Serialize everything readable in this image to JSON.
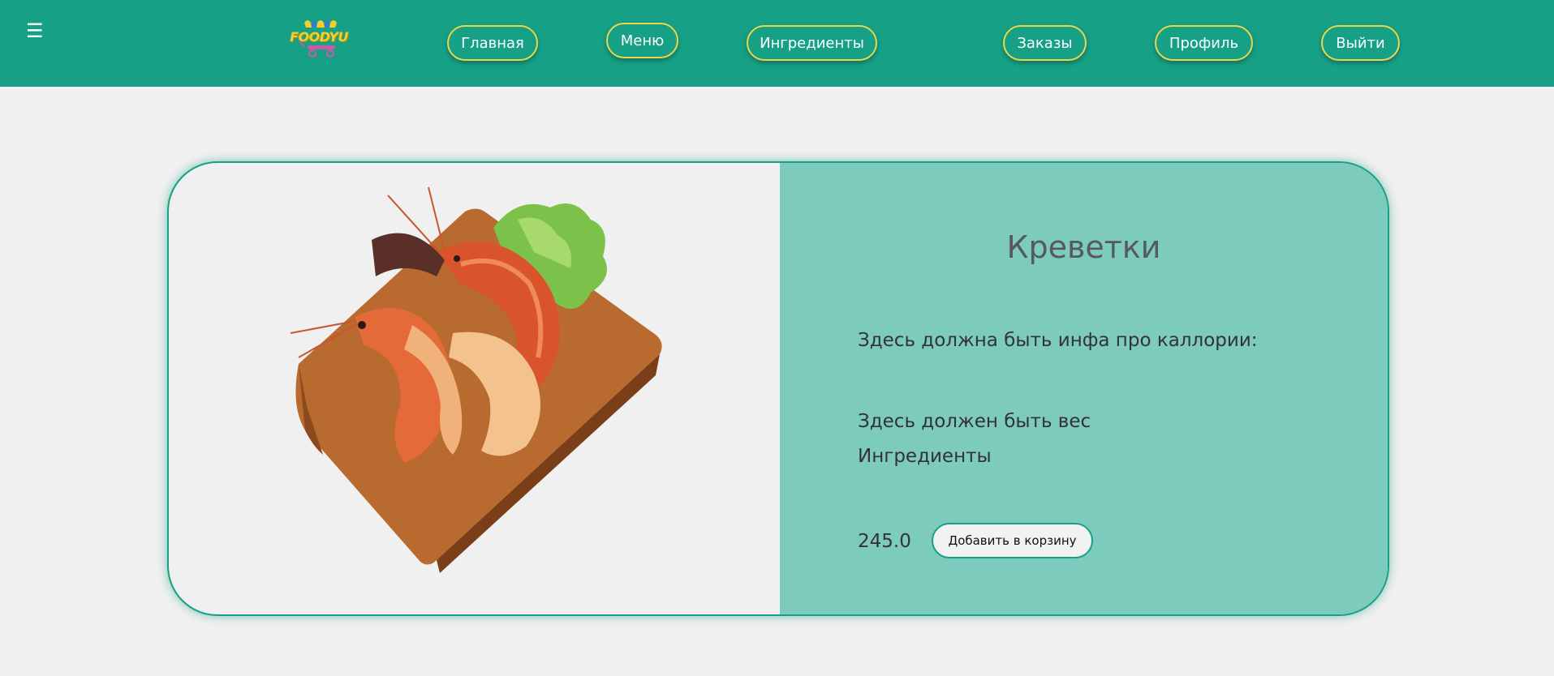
{
  "header": {
    "menu_icon": "hamburger-icon",
    "logo_text": "FOODYU",
    "nav": [
      {
        "label": "Главная"
      },
      {
        "label": "Меню"
      },
      {
        "label": "Ингредиенты"
      },
      {
        "label": "Заказы"
      },
      {
        "label": "Профиль"
      },
      {
        "label": "Выйти"
      }
    ]
  },
  "product": {
    "image": "shrimp-on-cutting-board",
    "title": "Креветки",
    "calories_text": "Здесь должна быть инфа про каллории:",
    "weight_text": "Здесь должен быть вес",
    "ingredients_text": "Ингредиенты",
    "price": "245.0",
    "add_to_cart_label": "Добавить в корзину"
  },
  "colors": {
    "header_bg": "#16a085",
    "nav_border": "#e8d84a",
    "info_pane_bg": "#7dcbbc",
    "page_bg": "#f0f0f0"
  }
}
